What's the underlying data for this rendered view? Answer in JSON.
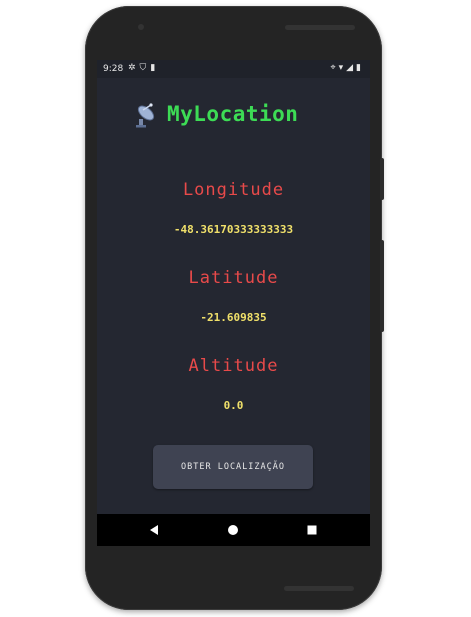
{
  "status_bar": {
    "time": "9:28"
  },
  "app": {
    "title": "MyLocation"
  },
  "fields": {
    "longitude": {
      "label": "Longitude",
      "value": "-48.36170333333333"
    },
    "latitude": {
      "label": "Latitude",
      "value": "-21.609835"
    },
    "altitude": {
      "label": "Altitude",
      "value": "0.0"
    }
  },
  "action_button": {
    "label": "OBTER LOCALIZAÇÃO"
  },
  "colors": {
    "title": "#3ddc55",
    "label": "#e84a4a",
    "value": "#f0e06a",
    "background": "#242731",
    "button": "#3f4352"
  }
}
